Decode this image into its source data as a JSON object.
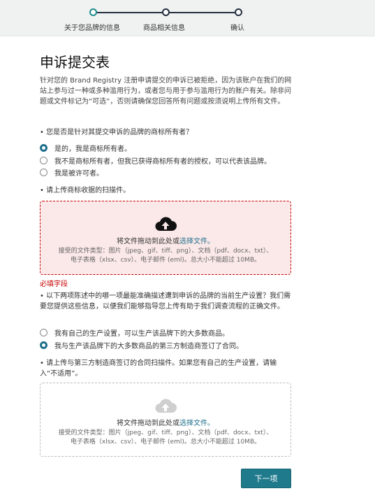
{
  "stepper": {
    "steps": [
      {
        "label": "关于您品牌的信息"
      },
      {
        "label": "商品相关信息"
      },
      {
        "label": "确认"
      }
    ]
  },
  "form": {
    "title": "申诉提交表",
    "intro": "针对您的 Brand Registry 注册申请提交的申诉已被拒绝，因为该账户在我们的网站上参与过一种或多种滥用行为，或者您与用于参与滥用行为的账户有关。除非问题或文件标记为“可选”，否则请确保您回答所有问题或按须说明上传所有文件。",
    "q1": {
      "text": "• 您是否是针对其提交申诉的品牌的商标所有者？",
      "options": [
        "是的，我是商标所有者。",
        "我不是商标所有者，但我已获得商标所有者的授权，可以代表该品牌。",
        "我是被许可者。"
      ]
    },
    "upload1": {
      "label": "• 请上传商标收据的扫描件。",
      "title_prefix": "将文件拖动到此处或",
      "title_link": "选择文件。",
      "sub1": "接受的文件类型：图片（jpeg、gif、tiff、png）、文档（pdf、docx、txt）、",
      "sub2": "电子表格（xlsx、csv）、电子邮件 (eml)。总大小不能超过 10MB。"
    },
    "required_text": "必填字段",
    "q2": {
      "text": "• 以下两项陈述中的哪一项最能准确描述遭到申诉的品牌的当前生产设置？我们需要您提供这些信息，以便我们能够指导您上传有助于我们调查流程的正确文件。",
      "options": [
        "我有自己的生产设置，可以生产该品牌下的大多数商品。",
        "我与生产该品牌下的大多数商品的第三方制造商签订了合同。"
      ]
    },
    "upload2": {
      "label": "• 请上传与第三方制造商签订的合同扫描件。如果您有自己的生产设置，请输入“不适用”。",
      "title_prefix": "将文件拖动到此处或",
      "title_link": "选择文件。",
      "sub1": "接受的文件类型：图片（jpeg、gif、tiff、png）、文档（pdf、docx、txt）、",
      "sub2": "电子表格（xlsx、csv）、电子邮件 (eml)。总大小不能超过 10MB。"
    },
    "next_button": "下一项"
  },
  "colors": {
    "accent": "#1f7a8c",
    "error": "#c40000",
    "error_bg": "#fbe8e8"
  },
  "icons": {
    "upload": "cloud-upload-icon"
  }
}
